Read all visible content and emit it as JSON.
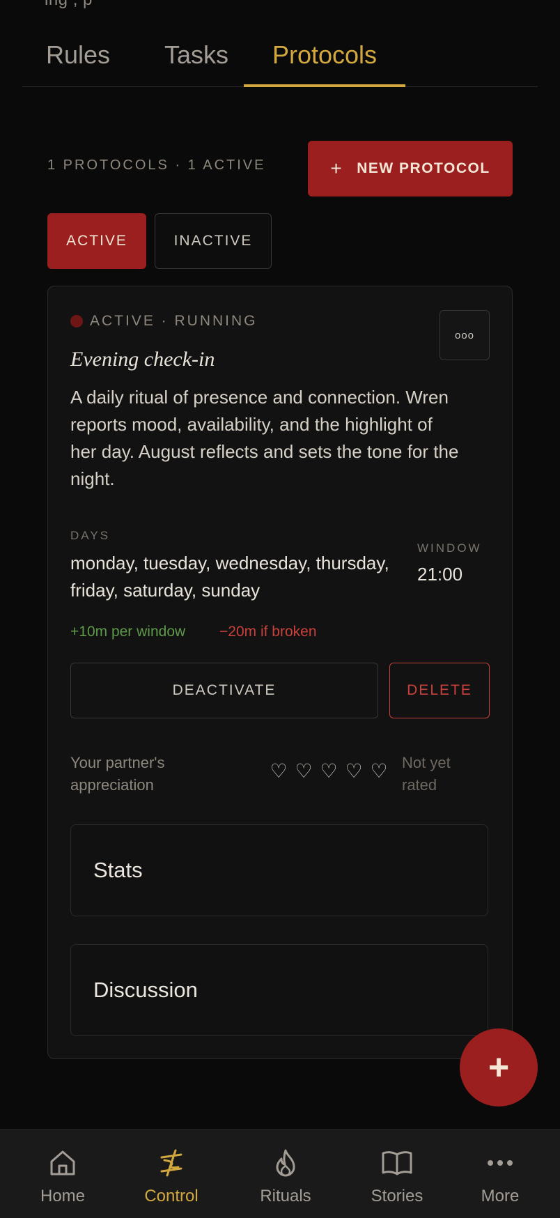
{
  "top_clip": "ing    ,         p",
  "tabs": [
    {
      "label": "Rules"
    },
    {
      "label": "Tasks"
    },
    {
      "label": "Protocols"
    }
  ],
  "summary": "1 PROTOCOLS · 1 ACTIVE",
  "new_protocol": {
    "icon": "plus-icon",
    "label": "NEW PROTOCOL"
  },
  "filters": {
    "active": "ACTIVE",
    "inactive": "INACTIVE"
  },
  "card": {
    "status": "ACTIVE · RUNNING",
    "menu_label": "ooo",
    "title": "Evening check-in",
    "description": "A daily ritual of presence and connection. Wren reports mood, availability, and the highlight of her day. August reflects and sets the tone for the night.",
    "days_label": "DAYS",
    "days_value": "monday, tuesday, wednesday, thursday, friday, saturday, sunday",
    "window_label": "WINDOW",
    "window_value": "21:00",
    "reward": "+10m per window",
    "penalty": "−20m if broken",
    "deactivate": "DEACTIVATE",
    "delete": "DELETE",
    "appreciation_label": "Your partner's appreciation",
    "heart_glyph": "♡",
    "appreciation_status": "Not yet rated",
    "stats_label": "Stats",
    "discussion_label": "Discussion"
  },
  "fab": {
    "label": "+"
  },
  "nav": [
    {
      "label": "Home",
      "icon": "home-icon"
    },
    {
      "label": "Control",
      "icon": "control-icon"
    },
    {
      "label": "Rituals",
      "icon": "flame-icon"
    },
    {
      "label": "Stories",
      "icon": "book-icon"
    },
    {
      "label": "More",
      "icon": "more-icon"
    }
  ],
  "colors": {
    "accent_red": "#9c1f1f",
    "gold": "#d3a93f",
    "reward_green": "#5f9a4a",
    "penalty_red": "#c9413c"
  }
}
